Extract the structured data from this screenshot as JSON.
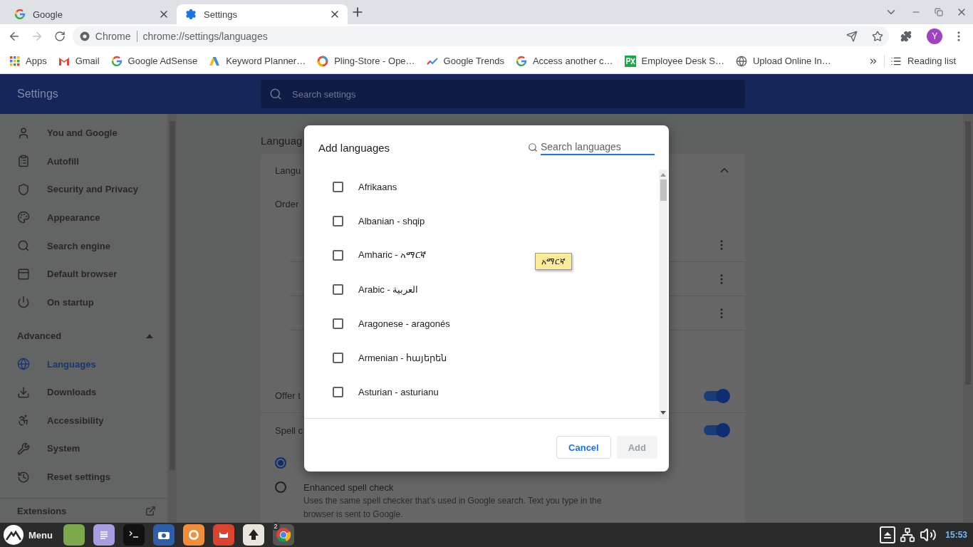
{
  "tabs": [
    {
      "title": "Google",
      "selected": false
    },
    {
      "title": "Settings",
      "selected": true
    }
  ],
  "toolbar": {
    "forward_disabled": true,
    "omnibox_label": "Chrome",
    "url": "chrome://settings/languages",
    "avatar": "Y"
  },
  "bookmarks": [
    {
      "label": "Apps"
    },
    {
      "label": "Gmail"
    },
    {
      "label": "Google AdSense"
    },
    {
      "label": "Keyword Planner…"
    },
    {
      "label": "Pling-Store - Ope…"
    },
    {
      "label": "Google Trends"
    },
    {
      "label": "Access another c…"
    },
    {
      "label": "Employee Desk S…"
    },
    {
      "label": "Upload Online In…"
    }
  ],
  "reading_list": "Reading list",
  "settings": {
    "title": "Settings",
    "search_placeholder": "Search settings",
    "sidebar": [
      {
        "kind": "item",
        "label": "You and Google",
        "selected": false
      },
      {
        "kind": "item",
        "label": "Autofill",
        "selected": false
      },
      {
        "kind": "item",
        "label": "Security and Privacy",
        "selected": false
      },
      {
        "kind": "item",
        "label": "Appearance",
        "selected": false
      },
      {
        "kind": "item",
        "label": "Search engine",
        "selected": false
      },
      {
        "kind": "item",
        "label": "Default browser",
        "selected": false
      },
      {
        "kind": "item",
        "label": "On startup",
        "selected": false
      },
      {
        "kind": "section",
        "label": "Advanced",
        "expanded": true
      },
      {
        "kind": "item",
        "label": "Languages",
        "selected": true
      },
      {
        "kind": "item",
        "label": "Downloads",
        "selected": false
      },
      {
        "kind": "item",
        "label": "Accessibility",
        "selected": false
      },
      {
        "kind": "item",
        "label": "System",
        "selected": false
      },
      {
        "kind": "item",
        "label": "Reset settings",
        "selected": false
      },
      {
        "kind": "link",
        "label": "Extensions"
      }
    ],
    "page_heading": "Languag",
    "card_heading": "Langu",
    "order_label": "Order",
    "offer_translate": {
      "label": "Offer t",
      "on": true
    },
    "spell_check": {
      "label": "Spell c",
      "on": true
    },
    "spell_options": [
      {
        "selected": true
      },
      {
        "label": "Enhanced spell check",
        "description": "Uses the same spell checker that’s used in Google search. Text you type in the browser is sent to Google.",
        "selected": false
      }
    ]
  },
  "dialog": {
    "title": "Add languages",
    "search_placeholder": "Search languages",
    "languages": [
      {
        "label": "Afrikaans",
        "checked": false
      },
      {
        "label": "Albanian - shqip",
        "checked": false
      },
      {
        "label": "Amharic - አማርኛ",
        "checked": false
      },
      {
        "label": "Arabic - العربية",
        "checked": false
      },
      {
        "label": "Aragonese - aragonés",
        "checked": false
      },
      {
        "label": "Armenian - հայերեն",
        "checked": false
      },
      {
        "label": "Asturian - asturianu",
        "checked": false
      }
    ],
    "cancel": "Cancel",
    "add": {
      "label": "Add",
      "disabled": true
    }
  },
  "tooltip": "አማርኛ",
  "taskbar": {
    "menu": "Menu",
    "badge": "2",
    "clock": "15:53"
  }
}
